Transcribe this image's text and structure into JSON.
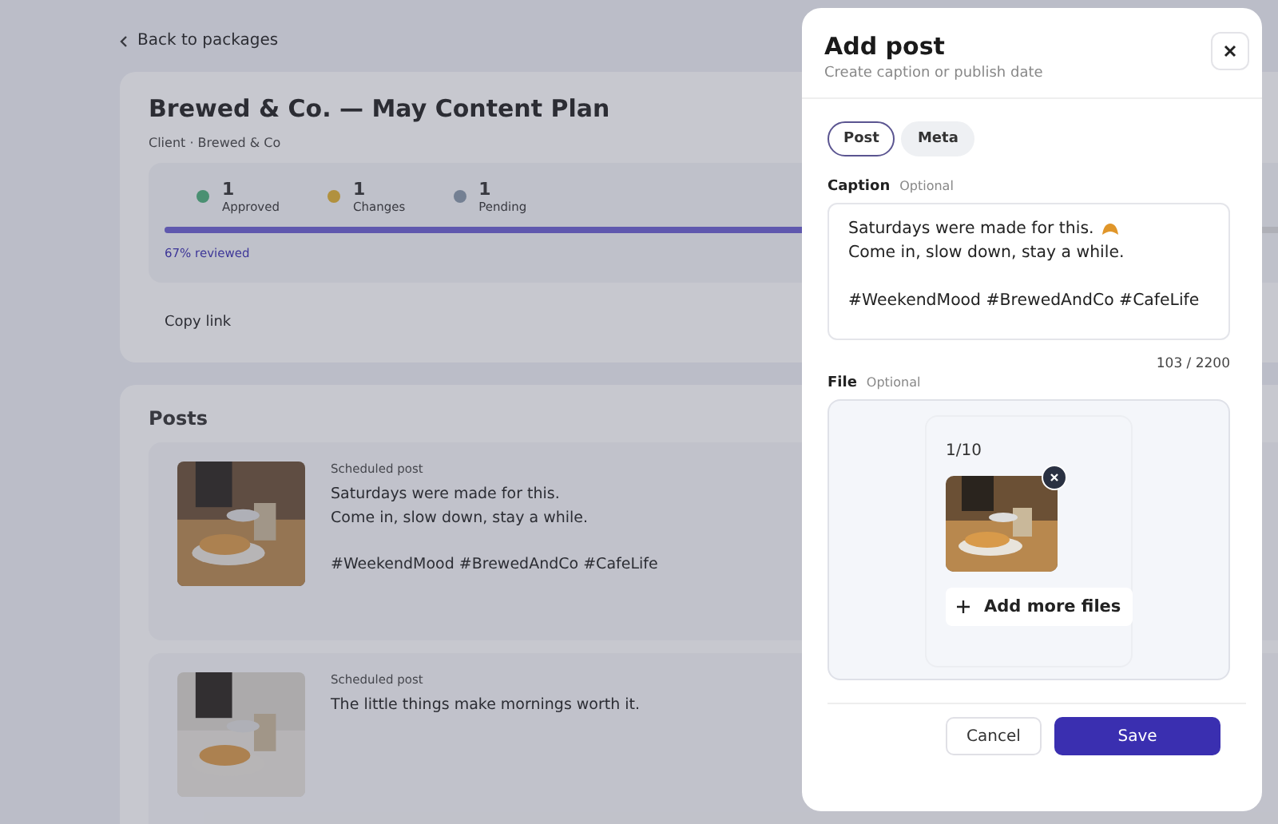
{
  "page": {
    "back_link": "Back to packages",
    "title": "Brewed & Co. — May Content Plan",
    "subtitle": "Client · Brewed & Co",
    "stats": [
      {
        "kind": "approved",
        "count": "1",
        "label": "Approved"
      },
      {
        "kind": "changes",
        "count": "1",
        "label": "Changes"
      },
      {
        "kind": "pending",
        "count": "1",
        "label": "Pending"
      }
    ],
    "progress": {
      "level": 0.67,
      "label": "67% reviewed"
    },
    "copy_link": "Copy link",
    "posts_title": "Posts",
    "posts": [
      {
        "date": "Scheduled post",
        "paragraphs": [
          [
            "Saturdays were made for this.",
            "Come in, slow down, stay a while."
          ],
          [
            "#WeekendMood #BrewedAndCo #CafeLife"
          ]
        ]
      },
      {
        "date": "Scheduled post",
        "paragraphs": [
          [
            "The little things make mornings worth it."
          ]
        ]
      }
    ]
  },
  "dialog": {
    "title": "Add post",
    "subtitle": "Create caption or publish date",
    "tabs": [
      {
        "label": "Post",
        "selected": true
      },
      {
        "label": "Meta",
        "selected": false
      }
    ],
    "caption": {
      "label": "Caption",
      "hint": "Optional",
      "paragraphs": [
        [
          "Saturdays were made for this.",
          "Come in, slow down, stay a while."
        ],
        [
          "#WeekendMood #BrewedAndCo #CafeLife"
        ]
      ],
      "counter": "103 / 2200"
    },
    "file": {
      "label": "File",
      "hint": "Optional",
      "count": "1/10",
      "add_more": "Add more files"
    },
    "buttons": [
      {
        "kind": "secondary",
        "label": "Cancel"
      },
      {
        "kind": "primary",
        "label": "Save"
      }
    ]
  }
}
